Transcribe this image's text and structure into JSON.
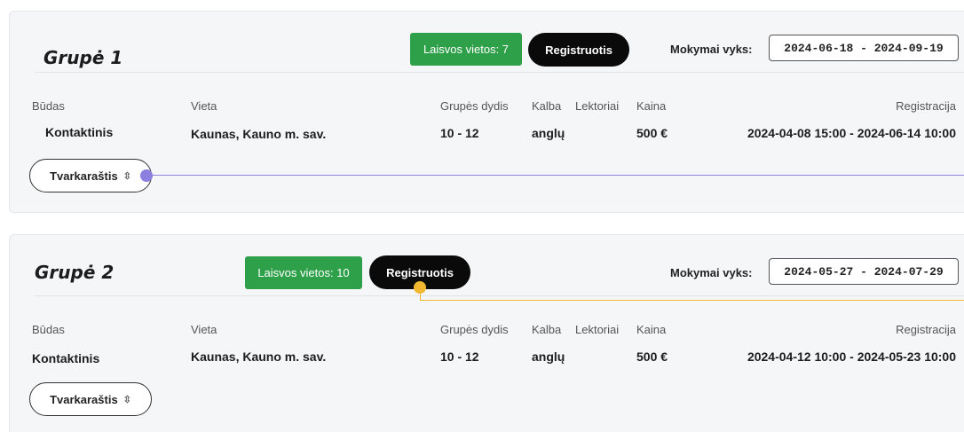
{
  "groups": [
    {
      "title": "Grupė 1",
      "free_spots": "Laisvos vietos: 7",
      "register_label": "Registruotis",
      "dates_label": "Mokymai vyks:",
      "dates_value": "2024-06-18 - 2024-09-19",
      "headers": {
        "mode": "Būdas",
        "place": "Vieta",
        "size": "Grupės dydis",
        "language": "Kalba",
        "lecturers": "Lektoriai",
        "price": "Kaina",
        "registration": "Registracija"
      },
      "values": {
        "mode": "Kontaktinis",
        "place": "Kaunas, Kauno m. sav.",
        "size": "10 - 12",
        "language": "anglų",
        "price": "500 €",
        "registration": "2024-04-08 15:00 - 2024-06-14 10:00"
      },
      "schedule_label": "Tvarkaraštis"
    },
    {
      "title": "Grupė 2",
      "free_spots": "Laisvos vietos: 10",
      "register_label": "Registruotis",
      "dates_label": "Mokymai vyks:",
      "dates_value": "2024-05-27 - 2024-07-29",
      "headers": {
        "mode": "Būdas",
        "place": "Vieta",
        "size": "Grupės dydis",
        "language": "Kalba",
        "lecturers": "Lektoriai",
        "price": "Kaina",
        "registration": "Registracija"
      },
      "values": {
        "mode": "Kontaktinis",
        "place": "Kaunas, Kauno m. sav.",
        "size": "10 - 12",
        "language": "anglų",
        "price": "500 €",
        "registration": "2024-04-12 10:00 - 2024-05-23 10:00"
      },
      "schedule_label": "Tvarkaraštis"
    }
  ],
  "colors": {
    "free_badge": "#2fa04a",
    "register_button": "#0a0a0a",
    "annotation_purple": "#8b7fe0",
    "annotation_yellow": "#f2b731"
  },
  "icons": {
    "schedule_toggle": "chevron-up-down-icon"
  }
}
